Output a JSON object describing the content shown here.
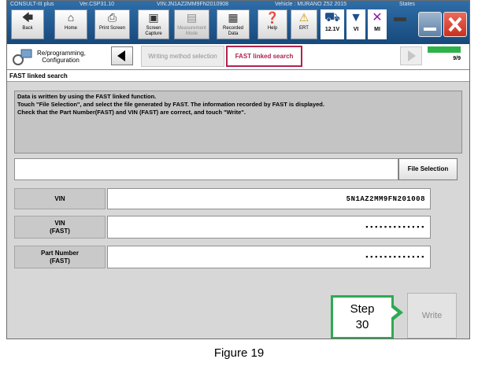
{
  "window": {
    "header_app": "CONSULT-III plus",
    "header_version": "Ver.CSP31.10",
    "header_vin": "VIN:JN1AZ2MM9FN2010908",
    "header_vehicle": "Vehicle : MURANO Z52 2015",
    "header_states": "States"
  },
  "toolbar": {
    "back": "Back",
    "home": "Home",
    "print_screen": "Print Screen",
    "screen_capture": "Screen Capture",
    "measurement_mode": "Measurement Mode",
    "recorded_data": "Recorded Data",
    "help": "Help",
    "ert": "ERT",
    "battery": "12.1V",
    "vi": "VI",
    "mi": "MI"
  },
  "nav": {
    "crumb_label": "Re/programming, Configuration",
    "step_prev": "Writing method selection",
    "step_current": "FAST linked search",
    "progress_text": "9/9",
    "progress_fraction": 1.0
  },
  "page": {
    "title": "FAST linked search",
    "message_lines": [
      "Data is written by using the FAST linked function.",
      "Touch \"File Selection\", and select the file generated by FAST. The information recorded by FAST is displayed.",
      "Check that the Part Number(FAST) and VIN (FAST) are correct, and touch \"Write\"."
    ],
    "file_selection_label": "File Selection",
    "fields": {
      "vin_label": "VIN",
      "vin_value": "5N1AZ2MM9FN201008",
      "vin_fast_label_1": "VIN",
      "vin_fast_label_2": "(FAST)",
      "vin_fast_value": "▪▪▪▪▪▪▪▪▪▪▪▪▪",
      "part_label_1": "Part Number",
      "part_label_2": "(FAST)",
      "part_value": "▪▪▪▪▪▪▪▪▪▪▪▪▪"
    },
    "write_label": "Write"
  },
  "callout": {
    "line1": "Step",
    "line2": "30"
  },
  "caption": "Figure 19",
  "colors": {
    "toolbar_blue": "#1f5a93",
    "callout_green": "#2dab52",
    "step_active_border": "#b0234e",
    "progress_green": "#2fb24a"
  }
}
